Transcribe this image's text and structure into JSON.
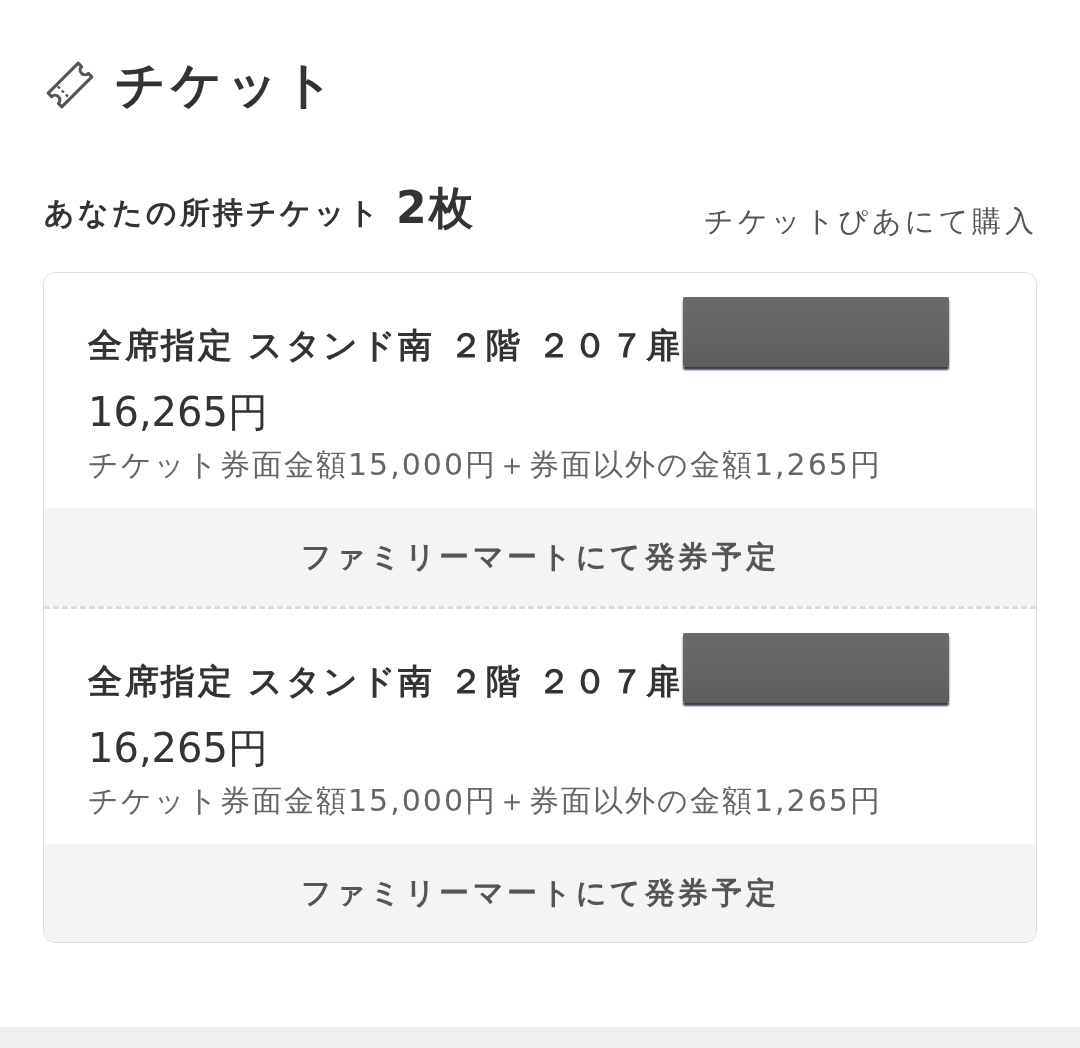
{
  "header": {
    "title": "チケット"
  },
  "summary": {
    "label": "あなたの所持チケット",
    "count": "2枚",
    "purchase_link": "チケットぴあにて購入"
  },
  "tickets": [
    {
      "seat": "全席指定 スタンド南 ２階 ２０７扉",
      "redacted": true,
      "price": "16,265円",
      "breakdown": "チケット券面金額15,000円＋券面以外の金額1,265円",
      "issuance": "ファミリーマートにて発券予定"
    },
    {
      "seat": "全席指定 スタンド南 ２階 ２０７扉",
      "redacted": true,
      "price": "16,265円",
      "breakdown": "チケット券面金額15,000円＋券面以外の金額1,265円",
      "issuance": "ファミリーマートにて発券予定"
    }
  ]
}
